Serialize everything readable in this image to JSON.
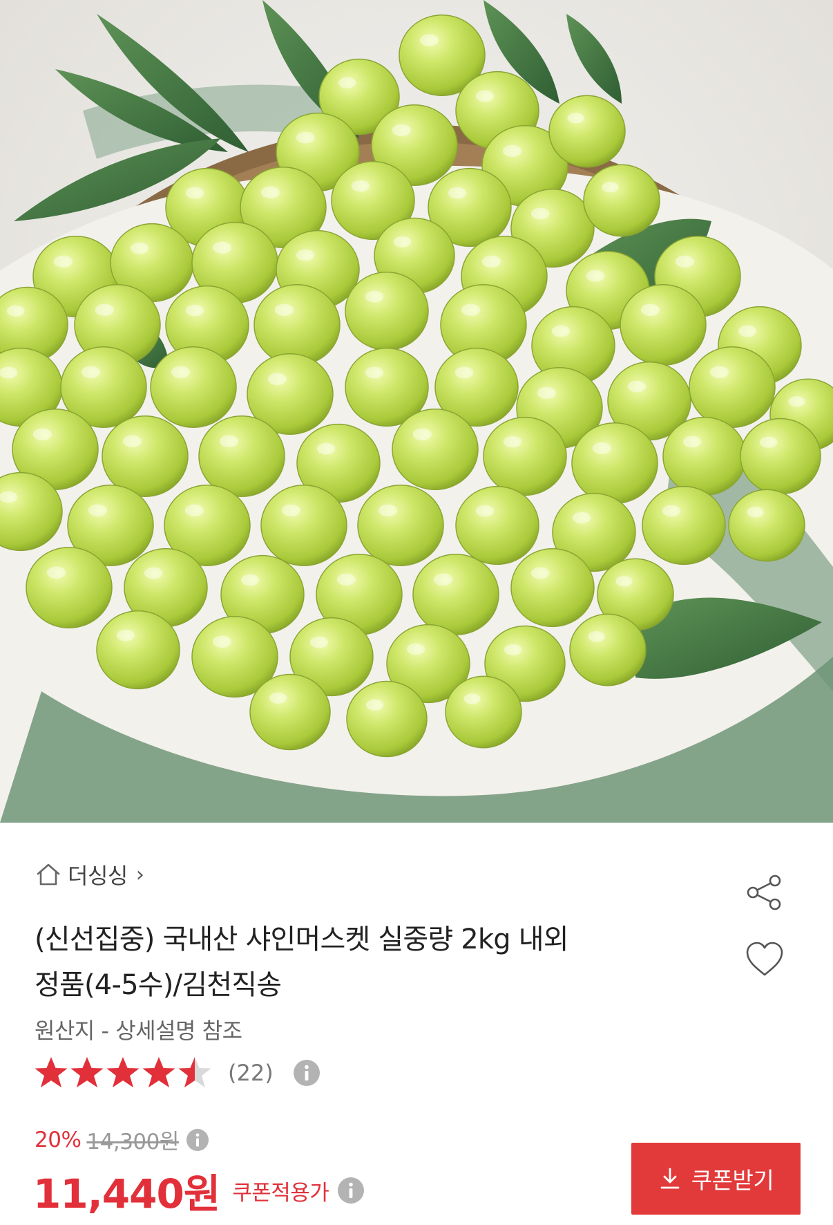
{
  "image": {
    "alt": "국내산 샤인머스켓"
  },
  "store": {
    "name": "더싱싱",
    "chevron": "›"
  },
  "product": {
    "title_line1": "(신선집중) 국내산 샤인머스켓 실중량 2kg 내외",
    "title_line2": "정품(4-5수)/김천직송",
    "origin": "원산지 - 상세설명 참조",
    "rating": 4.5,
    "rating_max": 5,
    "review_count": "(22)"
  },
  "price": {
    "discount_rate": "20%",
    "original_price": "14,300원",
    "final_price": "11,440원",
    "coupon_note": "쿠폰적용가"
  },
  "coupon_button": {
    "label": "쿠폰받기"
  },
  "colors": {
    "accent_red": "#e2303a",
    "coupon_button_bg": "#e23a3a",
    "star_filled": "#e2303a",
    "star_empty": "#d9d9d9",
    "info_icon": "#b3b3b3"
  },
  "icons": {
    "store": "home-icon",
    "share": "share-icon",
    "like": "heart-icon",
    "info": "info-icon",
    "coupon": "download-icon"
  }
}
